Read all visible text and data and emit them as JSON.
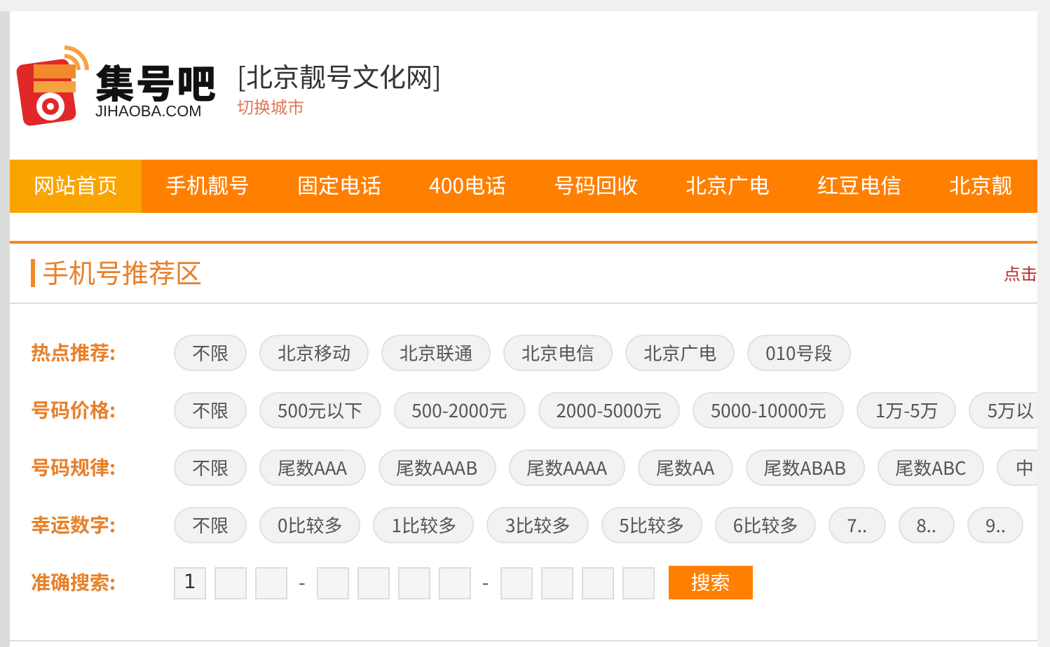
{
  "header": {
    "logo_name": "集号吧",
    "logo_domain": "JIHAOBA.COM",
    "site_title": "[北京靓号文化网]",
    "switch_city": "切换城市"
  },
  "nav": [
    {
      "label": "网站首页",
      "selected": true
    },
    {
      "label": "手机靓号",
      "selected": false
    },
    {
      "label": "固定电话",
      "selected": false
    },
    {
      "label": "400电话",
      "selected": false
    },
    {
      "label": "号码回收",
      "selected": false
    },
    {
      "label": "北京广电",
      "selected": false
    },
    {
      "label": "红豆电信",
      "selected": false
    },
    {
      "label": "北京靓",
      "selected": false
    }
  ],
  "section": {
    "title": "手机号推荐区",
    "more_link": "点击"
  },
  "filters": [
    {
      "label": "热点推荐:",
      "options": [
        "不限",
        "北京移动",
        "北京联通",
        "北京电信",
        "北京广电",
        "010号段"
      ]
    },
    {
      "label": "号码价格:",
      "options": [
        "不限",
        "500元以下",
        "500-2000元",
        "2000-5000元",
        "5000-10000元",
        "1万-5万",
        "5万以"
      ]
    },
    {
      "label": "号码规律:",
      "options": [
        "不限",
        "尾数AAA",
        "尾数AAAB",
        "尾数AAAA",
        "尾数AA",
        "尾数ABAB",
        "尾数ABC",
        "中"
      ]
    },
    {
      "label": "幸运数字:",
      "options": [
        "不限",
        "0比较多",
        "1比较多",
        "3比较多",
        "5比较多",
        "6比较多",
        "7..",
        "8..",
        "9.."
      ]
    }
  ],
  "exact_search": {
    "label": "准确搜索:",
    "items": [
      {
        "kind": "field",
        "value": "1"
      },
      {
        "kind": "field"
      },
      {
        "kind": "field"
      },
      {
        "kind": "separator",
        "text": "-"
      },
      {
        "kind": "field"
      },
      {
        "kind": "field"
      },
      {
        "kind": "field"
      },
      {
        "kind": "field"
      },
      {
        "kind": "separator",
        "text": "-"
      },
      {
        "kind": "field"
      },
      {
        "kind": "field"
      },
      {
        "kind": "field"
      },
      {
        "kind": "field"
      }
    ],
    "button": "搜索"
  }
}
